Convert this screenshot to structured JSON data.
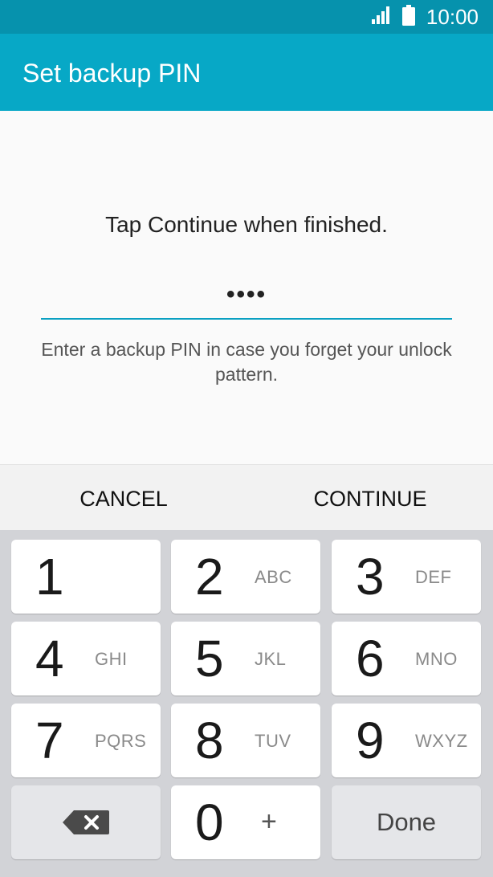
{
  "status_bar": {
    "time": "10:00",
    "signal_icon": "signal-icon",
    "battery_icon": "battery-icon"
  },
  "app_bar": {
    "title": "Set backup PIN"
  },
  "content": {
    "instruction": "Tap Continue when finished.",
    "pin_value": "••••",
    "help_text": "Enter a backup PIN in case you forget your unlock pattern."
  },
  "actions": {
    "cancel": "CANCEL",
    "continue": "CONTINUE"
  },
  "keypad": {
    "keys": [
      {
        "digit": "1",
        "letters": ""
      },
      {
        "digit": "2",
        "letters": "ABC"
      },
      {
        "digit": "3",
        "letters": "DEF"
      },
      {
        "digit": "4",
        "letters": "GHI"
      },
      {
        "digit": "5",
        "letters": "JKL"
      },
      {
        "digit": "6",
        "letters": "MNO"
      },
      {
        "digit": "7",
        "letters": "PQRS"
      },
      {
        "digit": "8",
        "letters": "TUV"
      },
      {
        "digit": "9",
        "letters": "WXYZ"
      },
      {
        "digit": "0",
        "letters": "+"
      }
    ],
    "backspace_icon": "backspace-icon",
    "done": "Done"
  },
  "colors": {
    "status_bar": "#0692ad",
    "app_bar": "#07a8c6",
    "accent": "#0aa0c2",
    "keypad_bg": "#d2d3d7"
  }
}
